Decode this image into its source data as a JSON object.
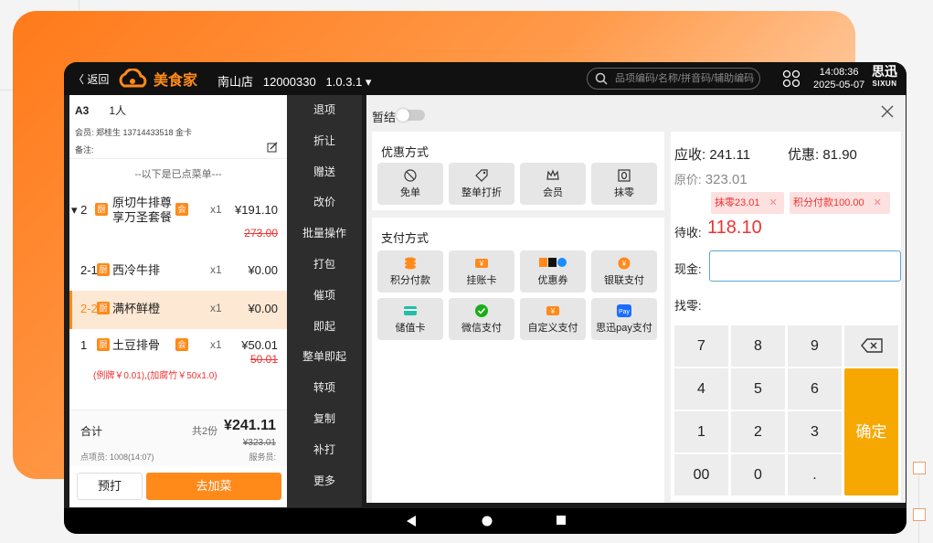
{
  "topbar": {
    "back": "〈 返回",
    "logo": "美食家",
    "store": "南山店",
    "store_code": "12000330",
    "version": "1.0.3.1 ▾",
    "search_placeholder": "品项编码/名称/拼音码/辅助编码",
    "time": "14:08:36",
    "date": "2025-05-07",
    "brand": "思迅",
    "brand_en": "SIXUN"
  },
  "order": {
    "table": "A3",
    "people": "1人",
    "member": "会员: 郑桂生 13714433518 金卡",
    "note_label": "备注:",
    "divider": "--以下是已点菜单---",
    "items": [
      {
        "idx": "▾ 2",
        "tag": "厨",
        "name": "原切牛排尊享万圣套餐",
        "badge": "会",
        "qty": "x1",
        "price": "¥191.10",
        "orig": "273.00"
      },
      {
        "idx": "2-1",
        "tag": "厨",
        "name": "西冷牛排",
        "qty": "x1",
        "price": "¥0.00"
      },
      {
        "idx": "2-2",
        "tag": "厨",
        "name": "满杯鲜橙",
        "qty": "x1",
        "price": "¥0.00"
      },
      {
        "idx": "1",
        "tag": "厨",
        "name": "土豆排骨",
        "badge": "会",
        "qty": "x1",
        "price": "¥50.01",
        "orig": "50.01",
        "remark": "(例牌￥0.01),(加腐竹￥50x1.0)"
      }
    ],
    "summary_label": "合计",
    "count": "共2份",
    "total": "¥241.11",
    "orig_total": "¥323.01",
    "waiter": "点项员: 1008(14:07)",
    "server": "服务员:",
    "btn_reserve": "预打",
    "btn_add": "去加菜"
  },
  "ops": [
    "退项",
    "折让",
    "赠送",
    "改价",
    "批量操作",
    "打包",
    "催项",
    "即起",
    "整单即起",
    "转项",
    "复制",
    "补打",
    "更多"
  ],
  "pay": {
    "hold_label": "暂结",
    "discount_title": "优惠方式",
    "discounts": [
      "免单",
      "整单打折",
      "会员",
      "抹零"
    ],
    "payment_title": "支付方式",
    "payments": [
      "积分付款",
      "挂账卡",
      "优惠券",
      "银联支付",
      "储值卡",
      "微信支付",
      "自定义支付",
      "思迅pay支付"
    ]
  },
  "settle": {
    "receivable_label": "应收:",
    "receivable": "241.11",
    "discount_label": "优惠:",
    "discount": "81.90",
    "orig_label": "原价:",
    "orig": "323.01",
    "chips": [
      "抹零23.01",
      "积分付款100.00"
    ],
    "due_label": "待收:",
    "due": "118.10",
    "cash_label": "现金:",
    "change_label": "找零:",
    "keys": [
      "7",
      "8",
      "9",
      "4",
      "5",
      "6",
      "1",
      "2",
      "3",
      "00",
      "0",
      "."
    ],
    "confirm": "确定"
  },
  "colors": {
    "accent": "#ff8a1a",
    "due": "#e33333",
    "confirm": "#f6a800"
  }
}
